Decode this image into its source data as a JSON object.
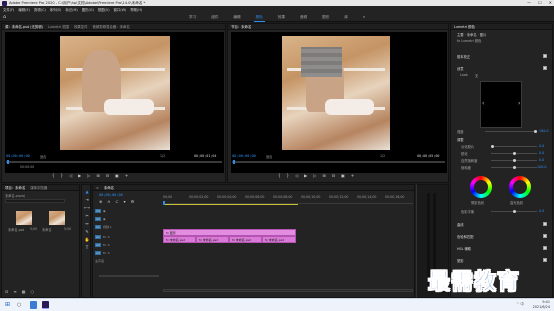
{
  "window": {
    "title": "Adobe Premiere Pro 2020 - C:\\用户\\hp\\文档\\Adobe\\Premiere Pro\\14.0\\未命名 *",
    "controls": [
      "—",
      "☐",
      "✕"
    ]
  },
  "menu": [
    "文件(F)",
    "编辑(E)",
    "剪辑(C)",
    "序列(S)",
    "标记(M)",
    "图形(G)",
    "视图(V)",
    "窗口(W)",
    "帮助(H)"
  ],
  "workspaces": {
    "tabs": [
      "学习",
      "组件",
      "编辑",
      "颜色",
      "效果",
      "音频",
      "图形",
      "库"
    ],
    "active_index": 3,
    "more": "»"
  },
  "source_monitor": {
    "tabs": [
      "源：未命名.psd (无剪辑)",
      "Lumetri 范围",
      "效果控件",
      "音频剪辑混合器：未命名"
    ],
    "timecode": "00;00;00;00",
    "fit": "适合",
    "zoom": "1/2",
    "duration": "00;00;01;04",
    "range_label": "00:00:00"
  },
  "program_monitor": {
    "tabs": [
      "节目：未命名"
    ],
    "timecode": "00;00;00;00",
    "fit": "适合",
    "zoom": "1/2",
    "duration": "00;00;05;00"
  },
  "lumetri": {
    "header": "Lumetri 颜色",
    "master": "主要 · 未命名 · 图片",
    "fx_label": "fx  Lumetri 颜色",
    "basic": "基本校正",
    "creative": "创意",
    "look_label": "Look",
    "look_value": "无",
    "sliders": [
      {
        "label": "强度",
        "value": "100.0"
      },
      {
        "label": "调整",
        "value": ""
      },
      {
        "label": "淡化胶片",
        "value": "0.0"
      },
      {
        "label": "锐化",
        "value": "0.0"
      },
      {
        "label": "自然饱和度",
        "value": "0.0"
      },
      {
        "label": "饱和度",
        "value": "100.0"
      }
    ],
    "wheels": [
      "阴影色彩",
      "高光色彩"
    ],
    "tint_balance": {
      "label": "色彩平衡",
      "value": "0.0"
    },
    "sections": [
      "曲线",
      "色轮和匹配",
      "HSL 辅助",
      "晕影"
    ]
  },
  "project": {
    "tabs": [
      "项目：未命名",
      "媒体浏览器"
    ],
    "path": "未命名.prproj",
    "items": [
      {
        "name": "未命名.psd",
        "duration": "5;00"
      },
      {
        "name": "未命名",
        "duration": "5;00"
      }
    ]
  },
  "timeline": {
    "tab": "未命名",
    "timecode": "00;00;00;00",
    "ruler": [
      "00;00",
      "00;00;02;00",
      "00;00;04;00",
      "00;00;06;00",
      "00;00;08;00",
      "00;00;10;00",
      "00;00;12;00",
      "00;00;14;00",
      "00;00;16;00",
      "00;00;18;00"
    ],
    "tracks": [
      {
        "tag": "V3",
        "label": ""
      },
      {
        "tag": "V2",
        "label": ""
      },
      {
        "tag": "V1",
        "label": "视频 1"
      },
      {
        "tag": "A1",
        "label": ""
      },
      {
        "tag": "A2",
        "label": ""
      },
      {
        "tag": "A3",
        "label": ""
      },
      {
        "tag": "",
        "label": "主声道"
      }
    ],
    "clips": [
      {
        "label": "fx 图形"
      },
      {
        "label": "fx 未命名.psd"
      },
      {
        "label": "fx 未命名.psd"
      },
      {
        "label": "fx 未命名.psd"
      },
      {
        "label": "fx 未命名.psd"
      }
    ]
  },
  "taskbar": {
    "time": "9:41",
    "date": "2021/6/24",
    "tray": "^ 中"
  },
  "watermark": "最需教育"
}
